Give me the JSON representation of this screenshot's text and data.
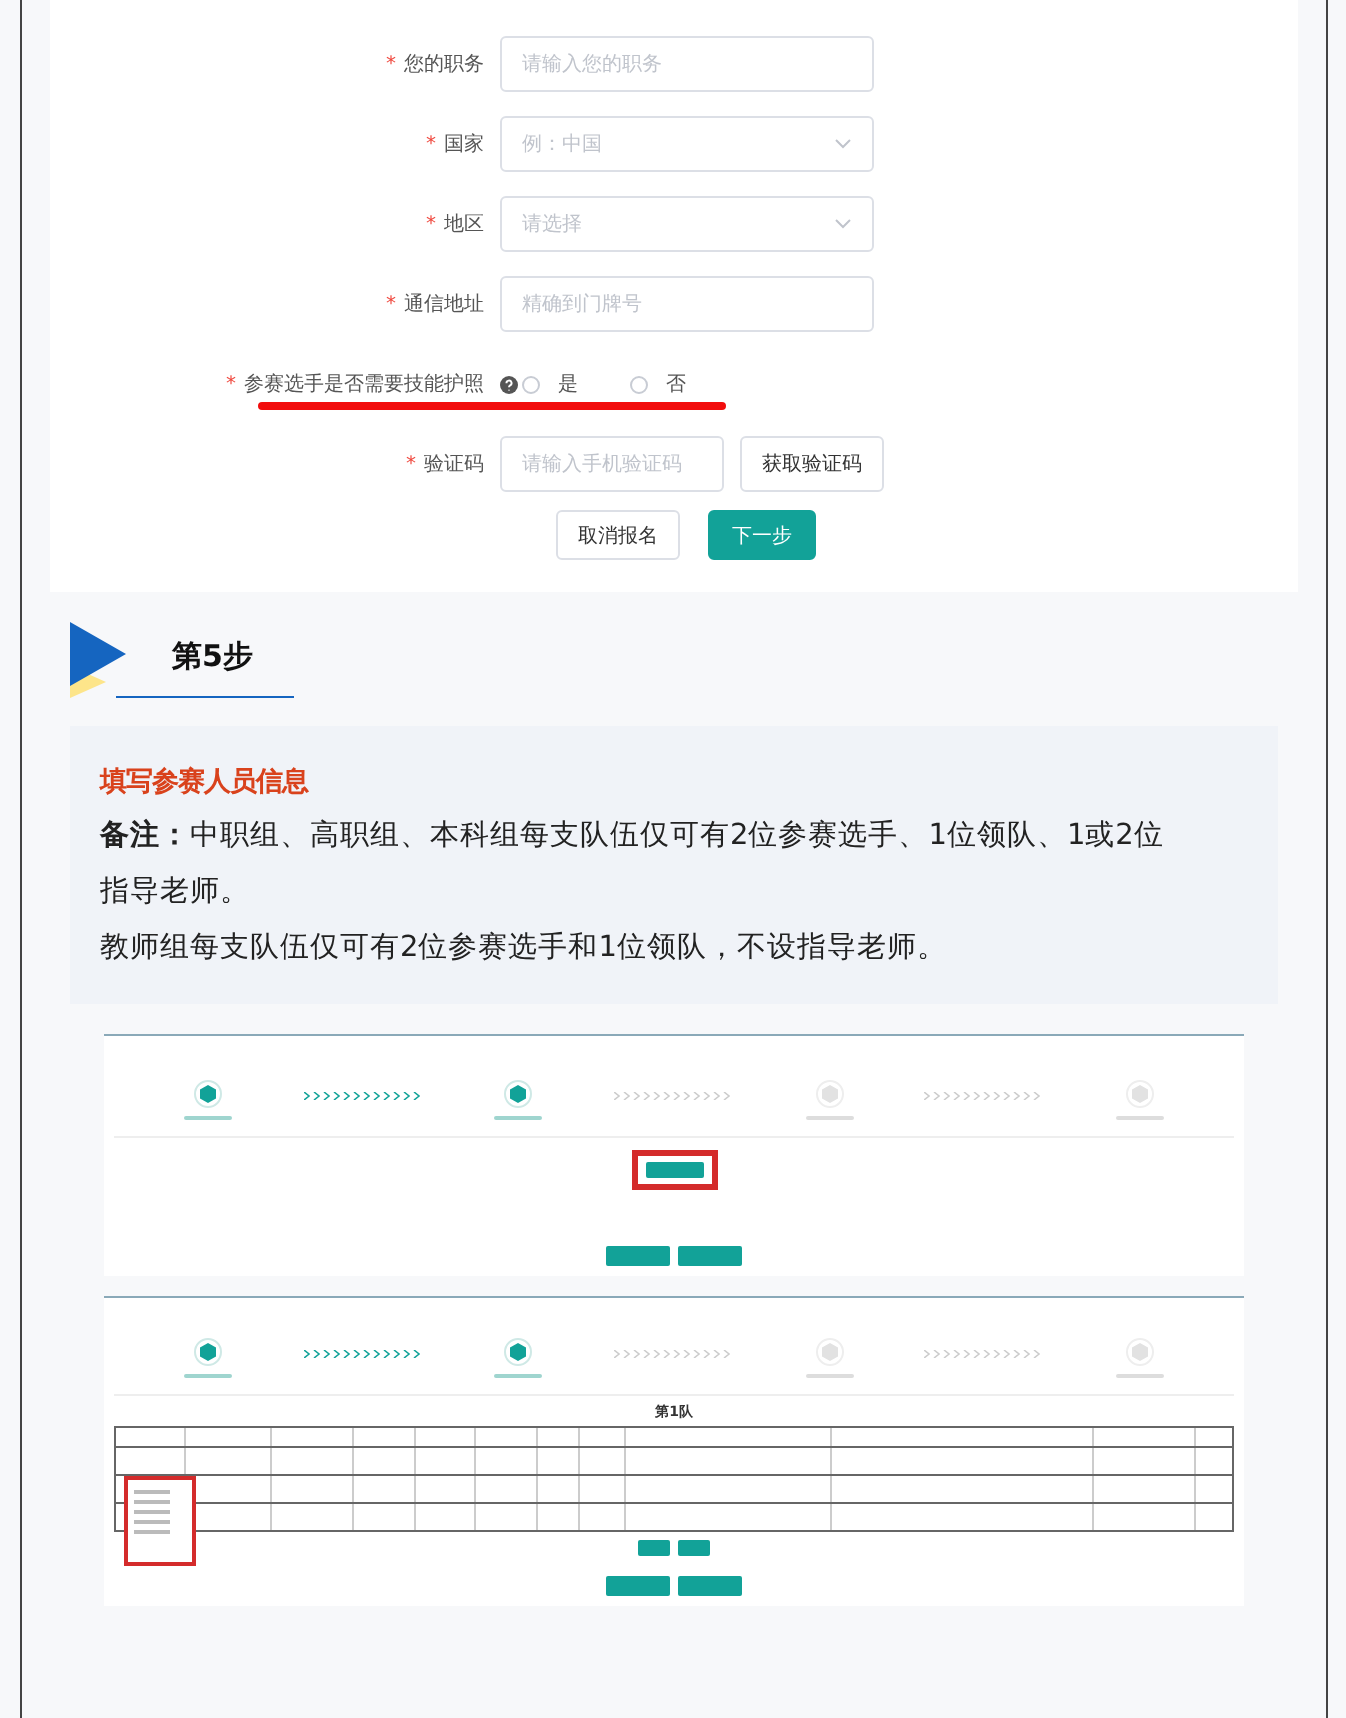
{
  "form": {
    "fields": [
      {
        "kind": "input",
        "mark": "*",
        "label": "您的职务",
        "placeholder": "请输入您的职务"
      },
      {
        "kind": "select",
        "mark": "*",
        "label": "国家",
        "placeholder": "例：中国"
      },
      {
        "kind": "select",
        "mark": "*",
        "label": "地区",
        "placeholder": "请选择"
      },
      {
        "kind": "input",
        "mark": "*",
        "label": "通信地址",
        "placeholder": "精确到门牌号"
      },
      {
        "kind": "radio",
        "mark": "*",
        "label": "参赛选手是否需要技能护照",
        "highlighted": true,
        "options": [
          {
            "label": "是",
            "selected": false
          },
          {
            "label": "否",
            "selected": false
          }
        ]
      },
      {
        "kind": "code",
        "mark": "*",
        "label": "验证码",
        "placeholder": "请输入手机验证码",
        "button": "获取验证码"
      }
    ],
    "buttons": [
      {
        "kind": "default",
        "label": "取消报名"
      },
      {
        "kind": "primary",
        "label": "下一步"
      }
    ]
  },
  "step": {
    "title": "第5步"
  },
  "notice": {
    "heading": "填写参赛人员信息",
    "paragraphs": [
      "**备注：**中职组、高职组、本科组每支队伍仅可有2位参赛选手、1位领队、1或2位指导老师。",
      "教师组每支队伍仅可有2位参赛选手和1位领队，不设指导老师。"
    ]
  },
  "screenshots": [
    {
      "kind": "add",
      "steps": [
        {
          "done": true
        },
        {
          "done": true
        },
        {
          "done": false
        },
        {
          "done": false
        }
      ]
    },
    {
      "kind": "table",
      "caption": "第1队",
      "steps": [
        {
          "done": true
        },
        {
          "done": true
        },
        {
          "done": false
        },
        {
          "done": false
        }
      ]
    }
  ]
}
